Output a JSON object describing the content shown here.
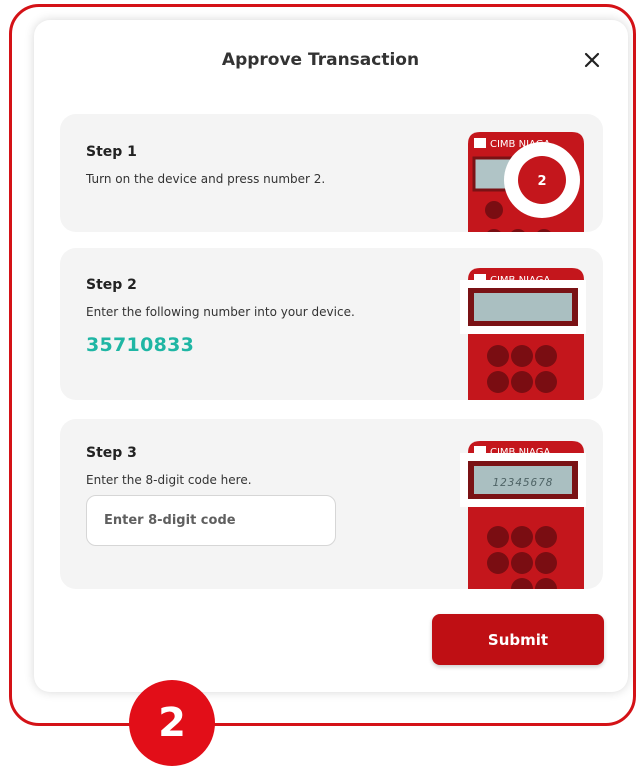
{
  "modal": {
    "title": "Approve Transaction",
    "close_icon": "close-icon"
  },
  "steps": [
    {
      "title": "Step 1",
      "description": "Turn on the device and press number 2.",
      "device": {
        "brand": "CIMB NIAGA",
        "highlight_key": "2"
      }
    },
    {
      "title": "Step 2",
      "description": "Enter the following number into your device.",
      "code": "35710833",
      "device": {
        "brand": "CIMB NIAGA"
      }
    },
    {
      "title": "Step 3",
      "description": "Enter the 8-digit code here.",
      "input": {
        "placeholder": "Enter 8-digit code",
        "value": ""
      },
      "device": {
        "brand": "CIMB NIAGA",
        "screen_text": "12345678"
      }
    }
  ],
  "submit_label": "Submit",
  "badge_number": "2",
  "colors": {
    "frame": "#d41217",
    "accent_red": "#bf0f14",
    "code_teal": "#1fb6a4",
    "card_bg": "#f4f4f4",
    "badge_red": "#e20e18"
  }
}
